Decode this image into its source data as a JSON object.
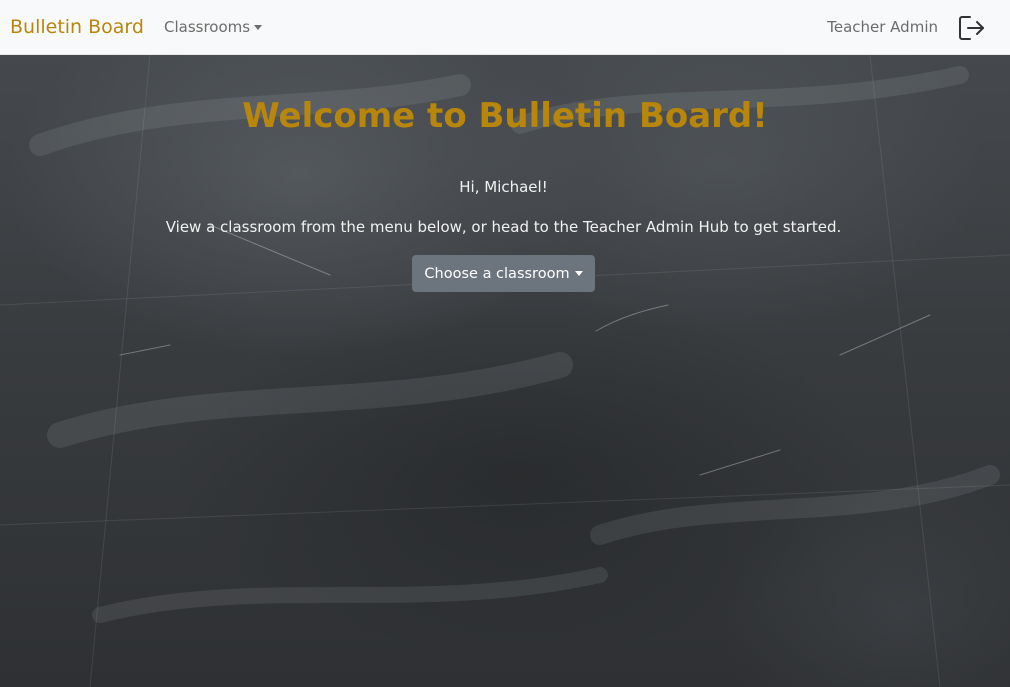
{
  "navbar": {
    "brand": "Bulletin Board",
    "classrooms_label": "Classrooms",
    "admin_label": "Teacher Admin",
    "logout_icon": "logout-icon"
  },
  "main": {
    "title": "Welcome to Bulletin Board!",
    "greeting": "Hi, Michael!",
    "instructions": "View a classroom from the menu below, or head to the Teacher Admin Hub to get started.",
    "choose_button": "Choose a classroom"
  },
  "colors": {
    "brand": "#b8860b",
    "navbar_bg": "#f8f9fa",
    "nav_text": "#6c6c6c",
    "board": "#3a3d40",
    "button": "#6c757d"
  }
}
